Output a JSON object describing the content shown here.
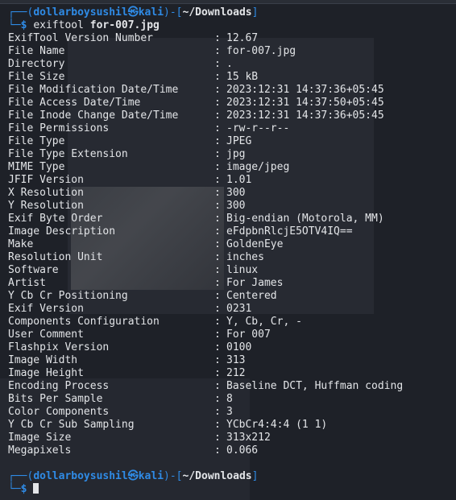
{
  "prompt": {
    "corner_top": "┌──(",
    "user_host": "dollarboysushil㉿kali",
    "mid": ")-[",
    "path": "~/Downloads",
    "end": "]",
    "corner_bottom": "└─",
    "dollar": "$"
  },
  "command": {
    "name": "exiftool",
    "arg": "for-007.jpg"
  },
  "separator": ":",
  "rows": [
    {
      "key": "ExifTool Version Number",
      "value": "12.67"
    },
    {
      "key": "File Name",
      "value": "for-007.jpg"
    },
    {
      "key": "Directory",
      "value": "."
    },
    {
      "key": "File Size",
      "value": "15 kB"
    },
    {
      "key": "File Modification Date/Time",
      "value": "2023:12:31 14:37:36+05:45"
    },
    {
      "key": "File Access Date/Time",
      "value": "2023:12:31 14:37:50+05:45"
    },
    {
      "key": "File Inode Change Date/Time",
      "value": "2023:12:31 14:37:36+05:45"
    },
    {
      "key": "File Permissions",
      "value": "-rw-r--r--"
    },
    {
      "key": "File Type",
      "value": "JPEG"
    },
    {
      "key": "File Type Extension",
      "value": "jpg"
    },
    {
      "key": "MIME Type",
      "value": "image/jpeg"
    },
    {
      "key": "JFIF Version",
      "value": "1.01"
    },
    {
      "key": "X Resolution",
      "value": "300"
    },
    {
      "key": "Y Resolution",
      "value": "300"
    },
    {
      "key": "Exif Byte Order",
      "value": "Big-endian (Motorola, MM)"
    },
    {
      "key": "Image Description",
      "value": "eFdpbnRlcjE5OTV4IQ=="
    },
    {
      "key": "Make",
      "value": "GoldenEye"
    },
    {
      "key": "Resolution Unit",
      "value": "inches"
    },
    {
      "key": "Software",
      "value": "linux"
    },
    {
      "key": "Artist",
      "value": "For James"
    },
    {
      "key": "Y Cb Cr Positioning",
      "value": "Centered"
    },
    {
      "key": "Exif Version",
      "value": "0231"
    },
    {
      "key": "Components Configuration",
      "value": "Y, Cb, Cr, -"
    },
    {
      "key": "User Comment",
      "value": "For 007"
    },
    {
      "key": "Flashpix Version",
      "value": "0100"
    },
    {
      "key": "Image Width",
      "value": "313"
    },
    {
      "key": "Image Height",
      "value": "212"
    },
    {
      "key": "Encoding Process",
      "value": "Baseline DCT, Huffman coding"
    },
    {
      "key": "Bits Per Sample",
      "value": "8"
    },
    {
      "key": "Color Components",
      "value": "3"
    },
    {
      "key": "Y Cb Cr Sub Sampling",
      "value": "YCbCr4:4:4 (1 1)"
    },
    {
      "key": "Image Size",
      "value": "313x212"
    },
    {
      "key": "Megapixels",
      "value": "0.066"
    }
  ],
  "colors": {
    "background": "#1e2128",
    "prompt_accent": "#2f8be6",
    "text": "#e3e5e8"
  }
}
